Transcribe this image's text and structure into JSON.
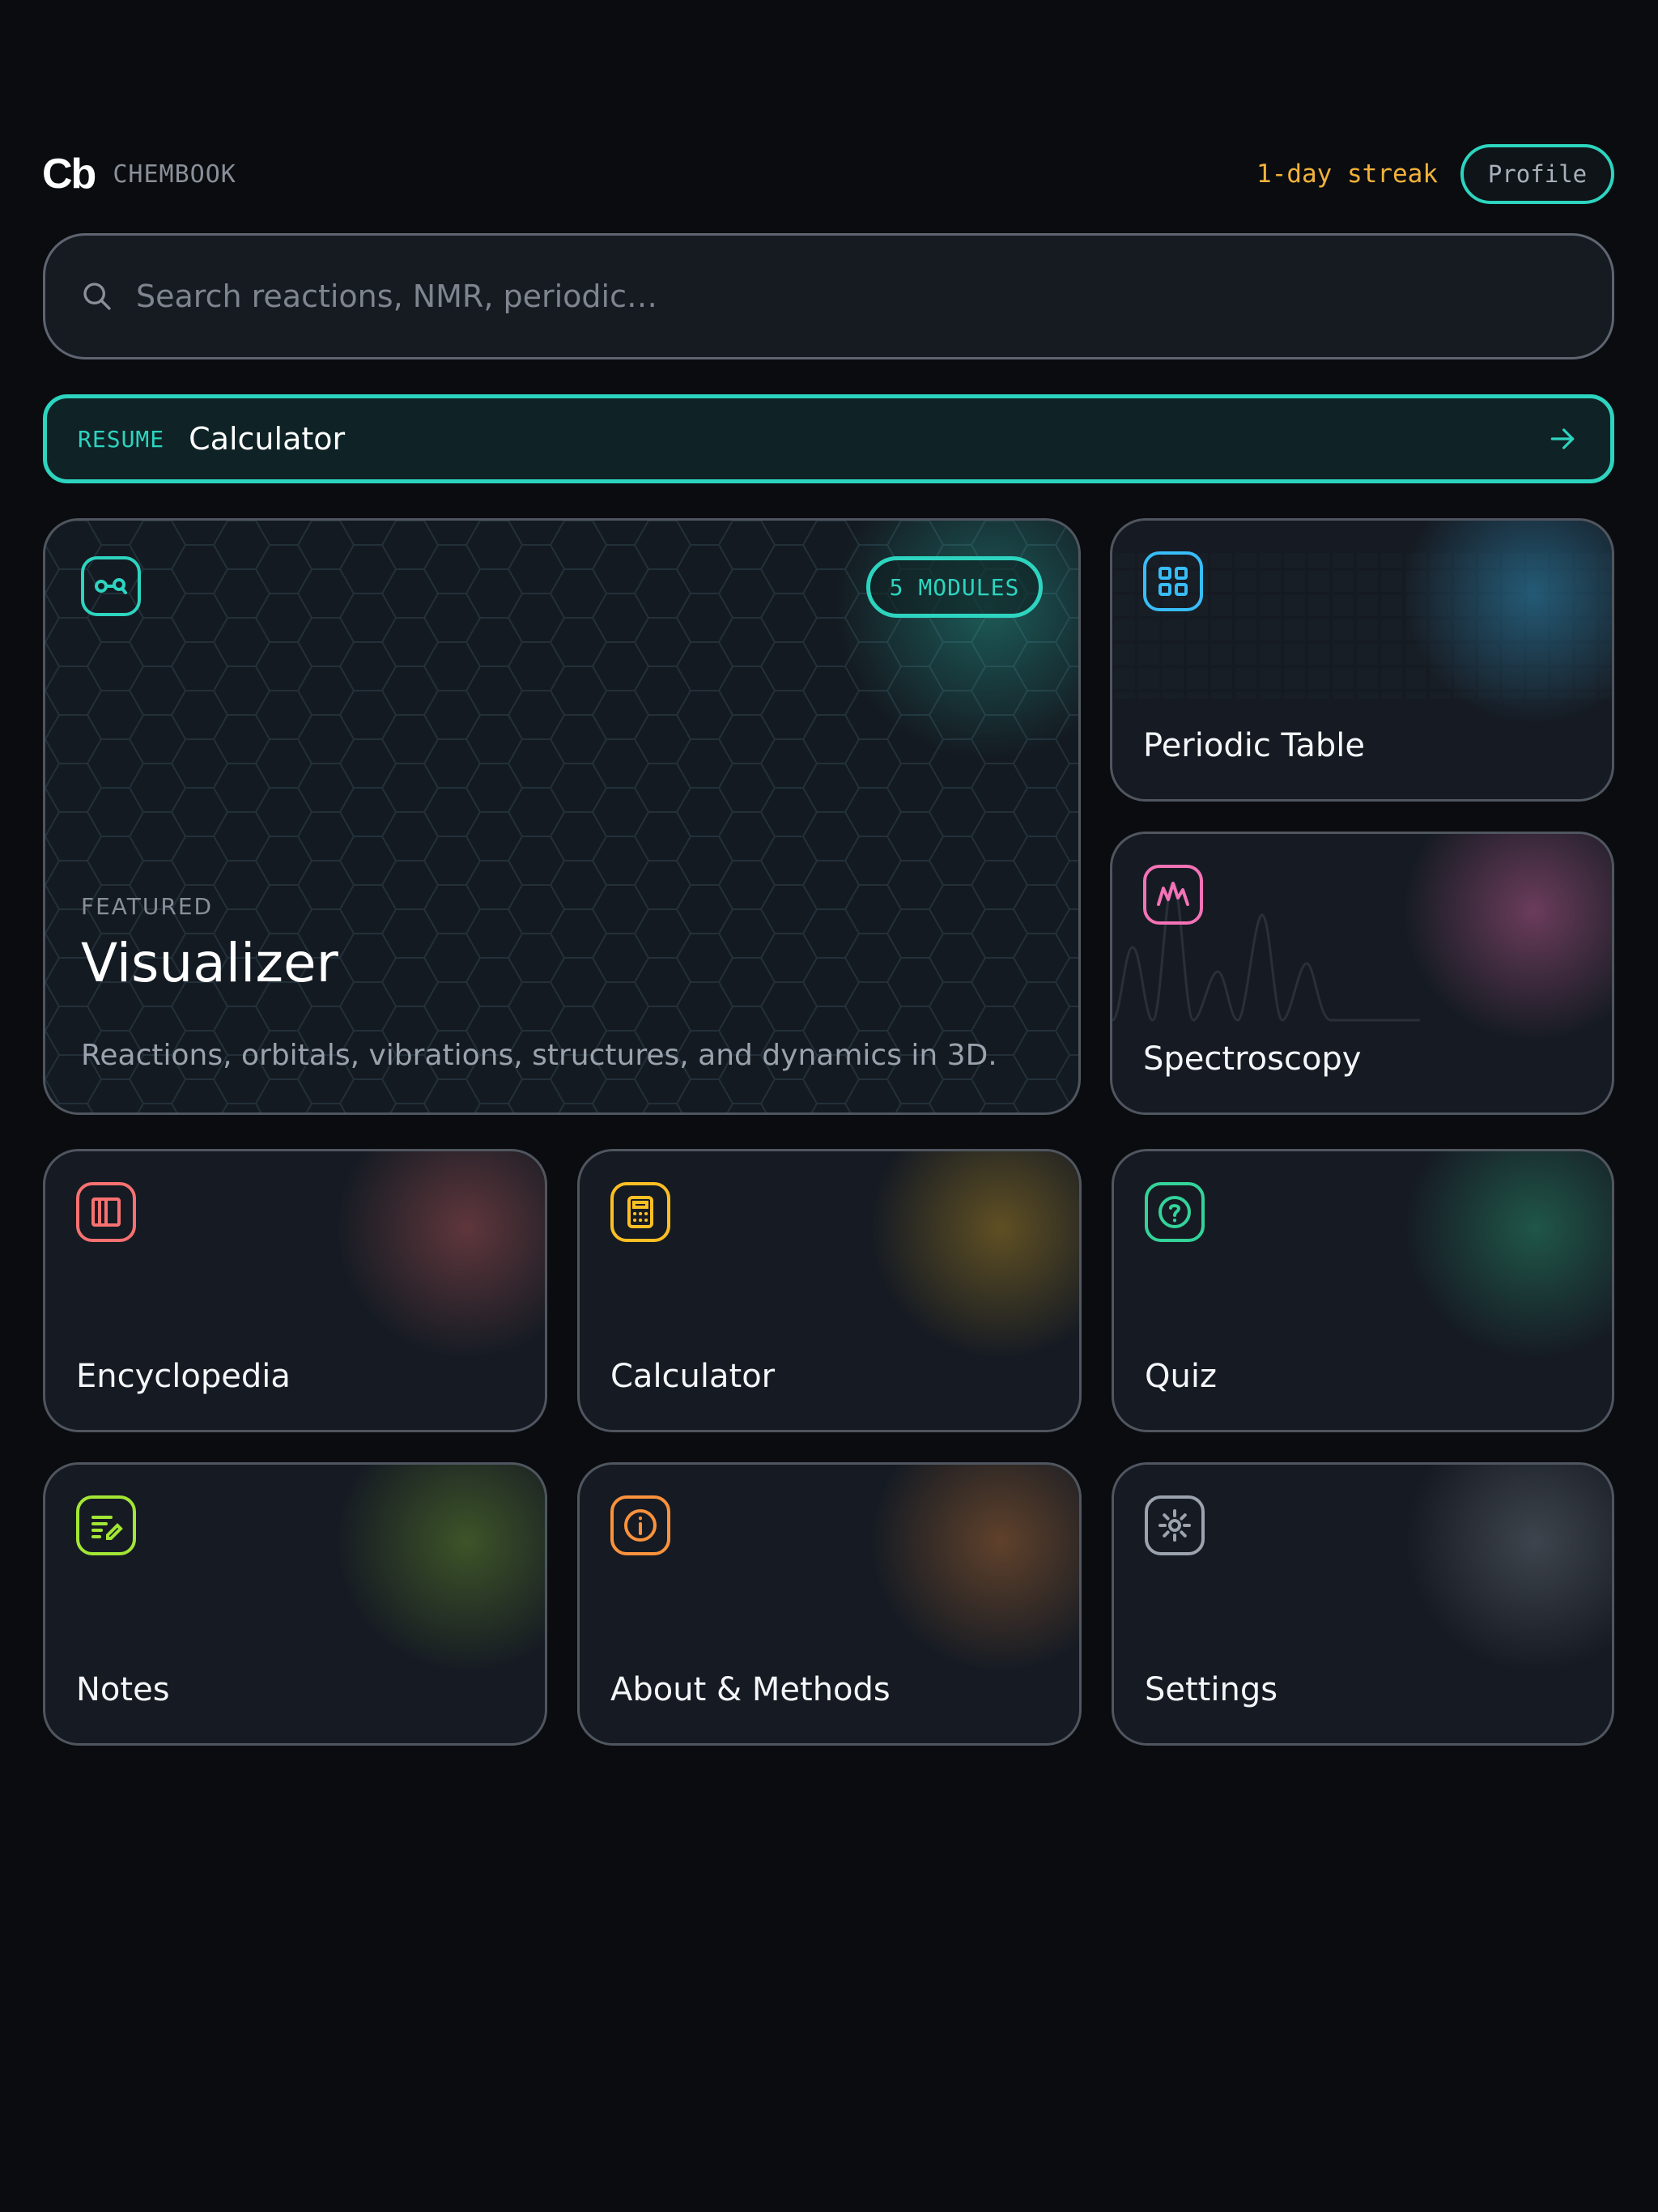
{
  "header": {
    "logo_mark": "Cb",
    "logo_word": "CHEMBOOK",
    "streak": "1-day streak",
    "profile_label": "Profile"
  },
  "search": {
    "placeholder": "Search reactions, NMR, periodic…",
    "value": "",
    "icon": "search-icon"
  },
  "resume": {
    "tag": "RESUME",
    "title": "Calculator",
    "icon": "arrow-right-icon"
  },
  "featured": {
    "label": "FEATURED",
    "title": "Visualizer",
    "description": "Reactions, orbitals, vibrations, structures, and dynamics in 3D.",
    "badge": "5 MODULES",
    "icon": "visualizer-icon",
    "accent": "#2dd4bf"
  },
  "cards": [
    {
      "title": "Periodic Table",
      "icon": "grid-icon",
      "accent": "#38bdf8"
    },
    {
      "title": "Spectroscopy",
      "icon": "spectrum-icon",
      "accent": "#f472b6"
    },
    {
      "title": "Encyclopedia",
      "icon": "book-icon",
      "accent": "#f87171"
    },
    {
      "title": "Calculator",
      "icon": "calculator-icon",
      "accent": "#fbbf24"
    },
    {
      "title": "Quiz",
      "icon": "question-icon",
      "accent": "#34d399"
    },
    {
      "title": "Notes",
      "icon": "notes-icon",
      "accent": "#a3e635"
    },
    {
      "title": "About & Methods",
      "icon": "info-icon",
      "accent": "#fb923c"
    },
    {
      "title": "Settings",
      "icon": "gear-icon",
      "accent": "#9ca3af"
    }
  ],
  "colors": {
    "background": "#0a0c10",
    "card": "#161b23",
    "accent": "#2dd4bf",
    "streak": "#f2b23a"
  }
}
